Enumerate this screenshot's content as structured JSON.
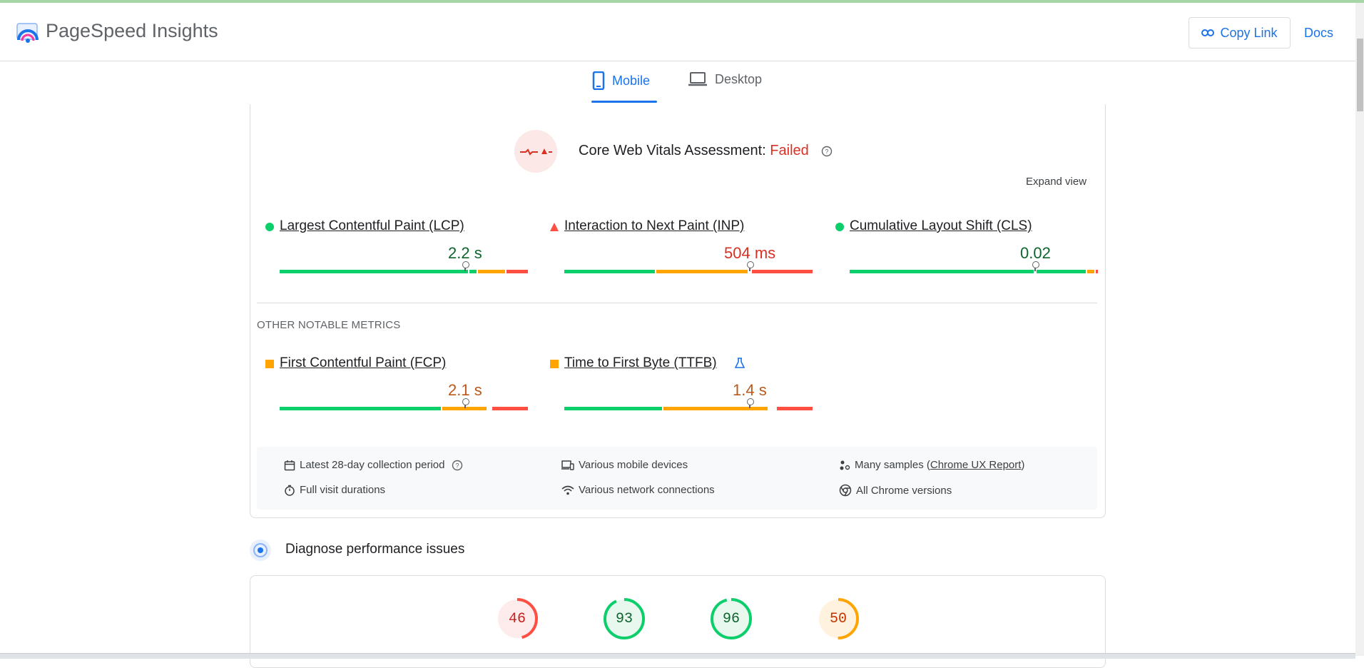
{
  "app": {
    "title": "PageSpeed Insights"
  },
  "header": {
    "copy_link_label": "Copy Link",
    "docs_label": "Docs"
  },
  "tabs": [
    {
      "label": "Mobile",
      "active": true
    },
    {
      "label": "Desktop",
      "active": false
    }
  ],
  "assessment": {
    "title": "Core Web Vitals Assessment:",
    "status": "Failed",
    "expand_label": "Expand view"
  },
  "core_metrics": [
    {
      "name": "Largest Contentful Paint (LCP)",
      "value": "2.2 s",
      "rating": "good",
      "color": "#0d652d"
    },
    {
      "name": "Interaction to Next Paint (INP)",
      "value": "504 ms",
      "rating": "poor",
      "color": "#d93025"
    },
    {
      "name": "Cumulative Layout Shift (CLS)",
      "value": "0.02",
      "rating": "good",
      "color": "#0d652d"
    }
  ],
  "other_metrics_label": "OTHER NOTABLE METRICS",
  "other_metrics": [
    {
      "name": "First Contentful Paint (FCP)",
      "value": "2.1 s",
      "rating": "needs-improvement",
      "color": "#b9591a"
    },
    {
      "name": "Time to First Byte (TTFB)",
      "value": "1.4 s",
      "rating": "needs-improvement",
      "color": "#b9591a",
      "experimental": true
    }
  ],
  "info": {
    "collection_period": "Latest 28-day collection period",
    "devices": "Various mobile devices",
    "samples_prefix": "Many samples (",
    "samples_link": "Chrome UX Report",
    "samples_suffix": ")",
    "durations": "Full visit durations",
    "network": "Various network connections",
    "chrome_versions": "All Chrome versions"
  },
  "diagnose": {
    "title": "Diagnose performance issues"
  },
  "scores": [
    {
      "value": "46",
      "rating": "poor"
    },
    {
      "value": "93",
      "rating": "good"
    },
    {
      "value": "96",
      "rating": "good"
    },
    {
      "value": "50",
      "rating": "average"
    }
  ],
  "colors": {
    "accent": "#1a73e8",
    "good": "#0cce6b",
    "average": "#ffa400",
    "poor": "#ff4e42"
  }
}
